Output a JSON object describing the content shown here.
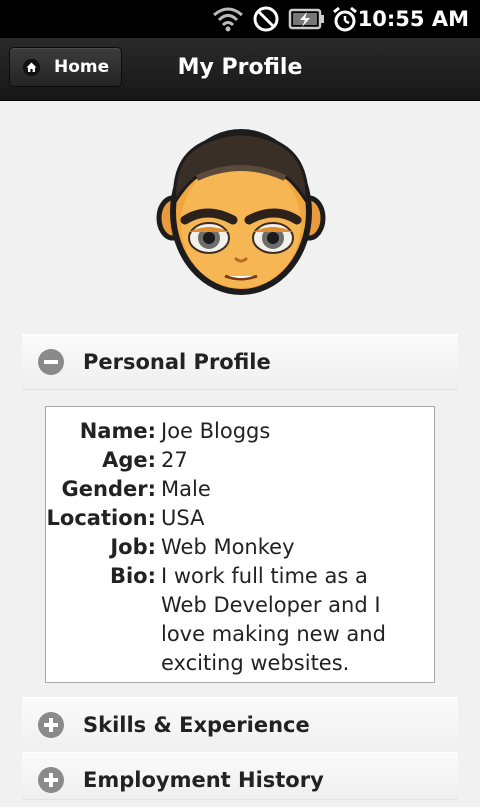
{
  "status_bar": {
    "time": "10:55 AM",
    "icons": [
      "wifi-icon",
      "no-signal-icon",
      "battery-charging-icon",
      "alarm-icon"
    ]
  },
  "header": {
    "home_label": "Home",
    "title": "My Profile"
  },
  "sections": {
    "personal": {
      "title": "Personal Profile",
      "state": "expanded",
      "fields": [
        {
          "label": "Name:",
          "value": "Joe Bloggs"
        },
        {
          "label": "Age:",
          "value": "27"
        },
        {
          "label": "Gender:",
          "value": "Male"
        },
        {
          "label": "Location:",
          "value": "USA"
        },
        {
          "label": "Job:",
          "value": "Web Monkey"
        },
        {
          "label": "Bio:",
          "value": "I work full time as a Web Developer and I love making new and exciting websites."
        }
      ]
    },
    "skills": {
      "title": "Skills & Experience",
      "state": "collapsed"
    },
    "employment": {
      "title": "Employment History",
      "state": "collapsed"
    }
  }
}
